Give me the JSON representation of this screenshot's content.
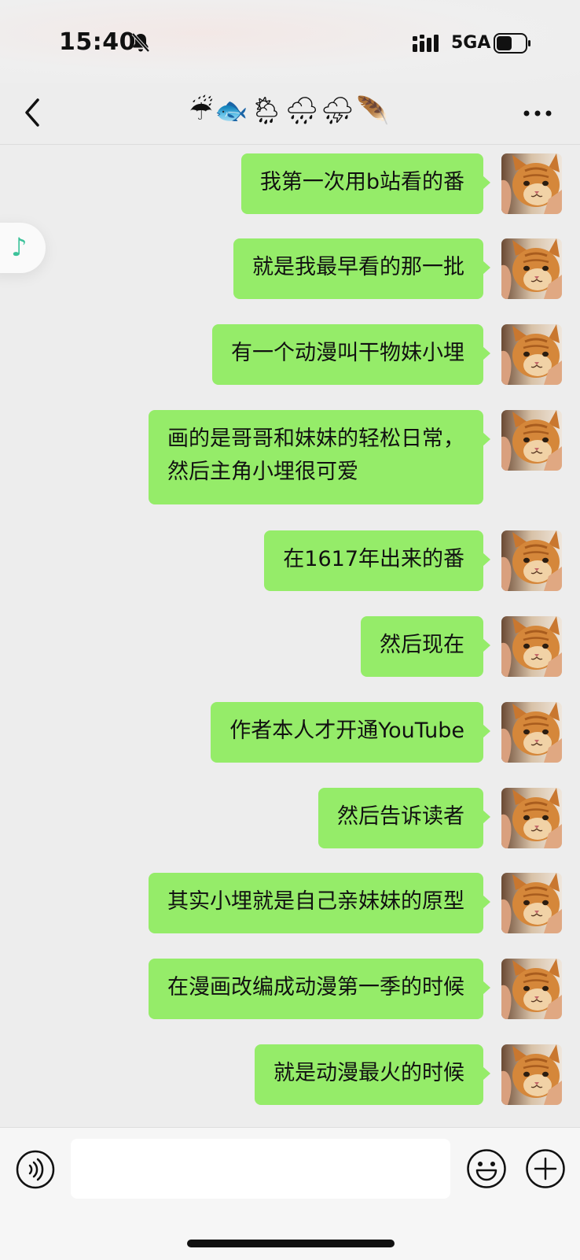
{
  "status_bar": {
    "time": "15:40",
    "network": "5GA",
    "battery_level": 0.55
  },
  "nav": {
    "title": "☔🐟🌦🌧⛈🪶"
  },
  "messages": [
    {
      "text": "我第一次用b站看的番"
    },
    {
      "text": "就是我最早看的那一批"
    },
    {
      "text": "有一个动漫叫干物妹小埋"
    },
    {
      "text": "画的是哥哥和妹妹的轻松日常，\n然后主角小埋很可爱"
    },
    {
      "text": "在1617年出来的番"
    },
    {
      "text": "然后现在"
    },
    {
      "text": "作者本人才开通YouTube"
    },
    {
      "text": "然后告诉读者"
    },
    {
      "text": "其实小埋就是自己亲妹妹的原型"
    },
    {
      "text": "在漫画改编成动漫第一季的时候"
    },
    {
      "text": "就是动漫最火的时候"
    }
  ],
  "input": {
    "value": "",
    "placeholder": ""
  },
  "colors": {
    "bubble": "#95ec69",
    "background": "#ededed",
    "accent": "#3cc29a"
  }
}
